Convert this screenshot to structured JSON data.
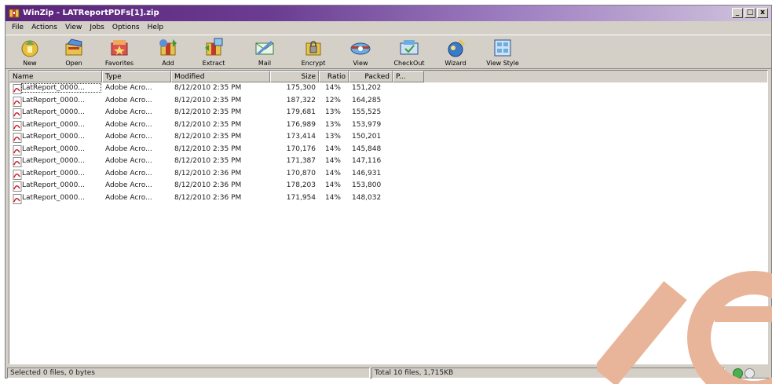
{
  "window": {
    "title": "WinZip - LATReportPDFs[1].zip"
  },
  "window_buttons": [
    "_",
    "□",
    "x"
  ],
  "menu": [
    "File",
    "Actions",
    "View",
    "Jobs",
    "Options",
    "Help"
  ],
  "toolbar": [
    {
      "label": "New",
      "icon": "new-icon"
    },
    {
      "label": "Open",
      "icon": "open-icon"
    },
    {
      "label": "Favorites",
      "icon": "favorites-icon"
    },
    {
      "label": "Add",
      "icon": "add-icon"
    },
    {
      "label": "Extract",
      "icon": "extract-icon"
    },
    {
      "label": "Mail",
      "icon": "mail-icon"
    },
    {
      "label": "Encrypt",
      "icon": "encrypt-icon"
    },
    {
      "label": "View",
      "icon": "view-icon"
    },
    {
      "label": "CheckOut",
      "icon": "checkout-icon"
    },
    {
      "label": "Wizard",
      "icon": "wizard-icon"
    },
    {
      "label": "View Style",
      "icon": "view-style-icon"
    }
  ],
  "columns": [
    "Name",
    "Type",
    "Modified",
    "Size",
    "Ratio",
    "Packed",
    "P..."
  ],
  "files": [
    {
      "name": "LatReport_0000...",
      "type": "Adobe Acro...",
      "modified": "8/12/2010 2:35 PM",
      "size": "175,300",
      "ratio": "14%",
      "packed": "151,202"
    },
    {
      "name": "LatReport_0000...",
      "type": "Adobe Acro...",
      "modified": "8/12/2010 2:35 PM",
      "size": "187,322",
      "ratio": "12%",
      "packed": "164,285"
    },
    {
      "name": "LatReport_0000...",
      "type": "Adobe Acro...",
      "modified": "8/12/2010 2:35 PM",
      "size": "179,681",
      "ratio": "13%",
      "packed": "155,525"
    },
    {
      "name": "LatReport_0000...",
      "type": "Adobe Acro...",
      "modified": "8/12/2010 2:35 PM",
      "size": "176,989",
      "ratio": "13%",
      "packed": "153,979"
    },
    {
      "name": "LatReport_0000...",
      "type": "Adobe Acro...",
      "modified": "8/12/2010 2:35 PM",
      "size": "173,414",
      "ratio": "13%",
      "packed": "150,201"
    },
    {
      "name": "LatReport_0000...",
      "type": "Adobe Acro...",
      "modified": "8/12/2010 2:35 PM",
      "size": "170,176",
      "ratio": "14%",
      "packed": "145,848"
    },
    {
      "name": "LatReport_0000...",
      "type": "Adobe Acro...",
      "modified": "8/12/2010 2:35 PM",
      "size": "171,387",
      "ratio": "14%",
      "packed": "147,116"
    },
    {
      "name": "LatReport_0000...",
      "type": "Adobe Acro...",
      "modified": "8/12/2010 2:36 PM",
      "size": "170,870",
      "ratio": "14%",
      "packed": "146,931"
    },
    {
      "name": "LatReport_0000...",
      "type": "Adobe Acro...",
      "modified": "8/12/2010 2:36 PM",
      "size": "178,203",
      "ratio": "14%",
      "packed": "153,800"
    },
    {
      "name": "LatReport_0000...",
      "type": "Adobe Acro...",
      "modified": "8/12/2010 2:36 PM",
      "size": "171,954",
      "ratio": "14%",
      "packed": "148,032"
    }
  ],
  "status": {
    "selected": "Selected 0 files, 0 bytes",
    "total": "Total 10 files, 1,715KB"
  },
  "colors": {
    "title_start": "#5a237a",
    "title_end": "#d2c5de",
    "watermark": "#e8b49a",
    "status_light": "#4caf50"
  }
}
